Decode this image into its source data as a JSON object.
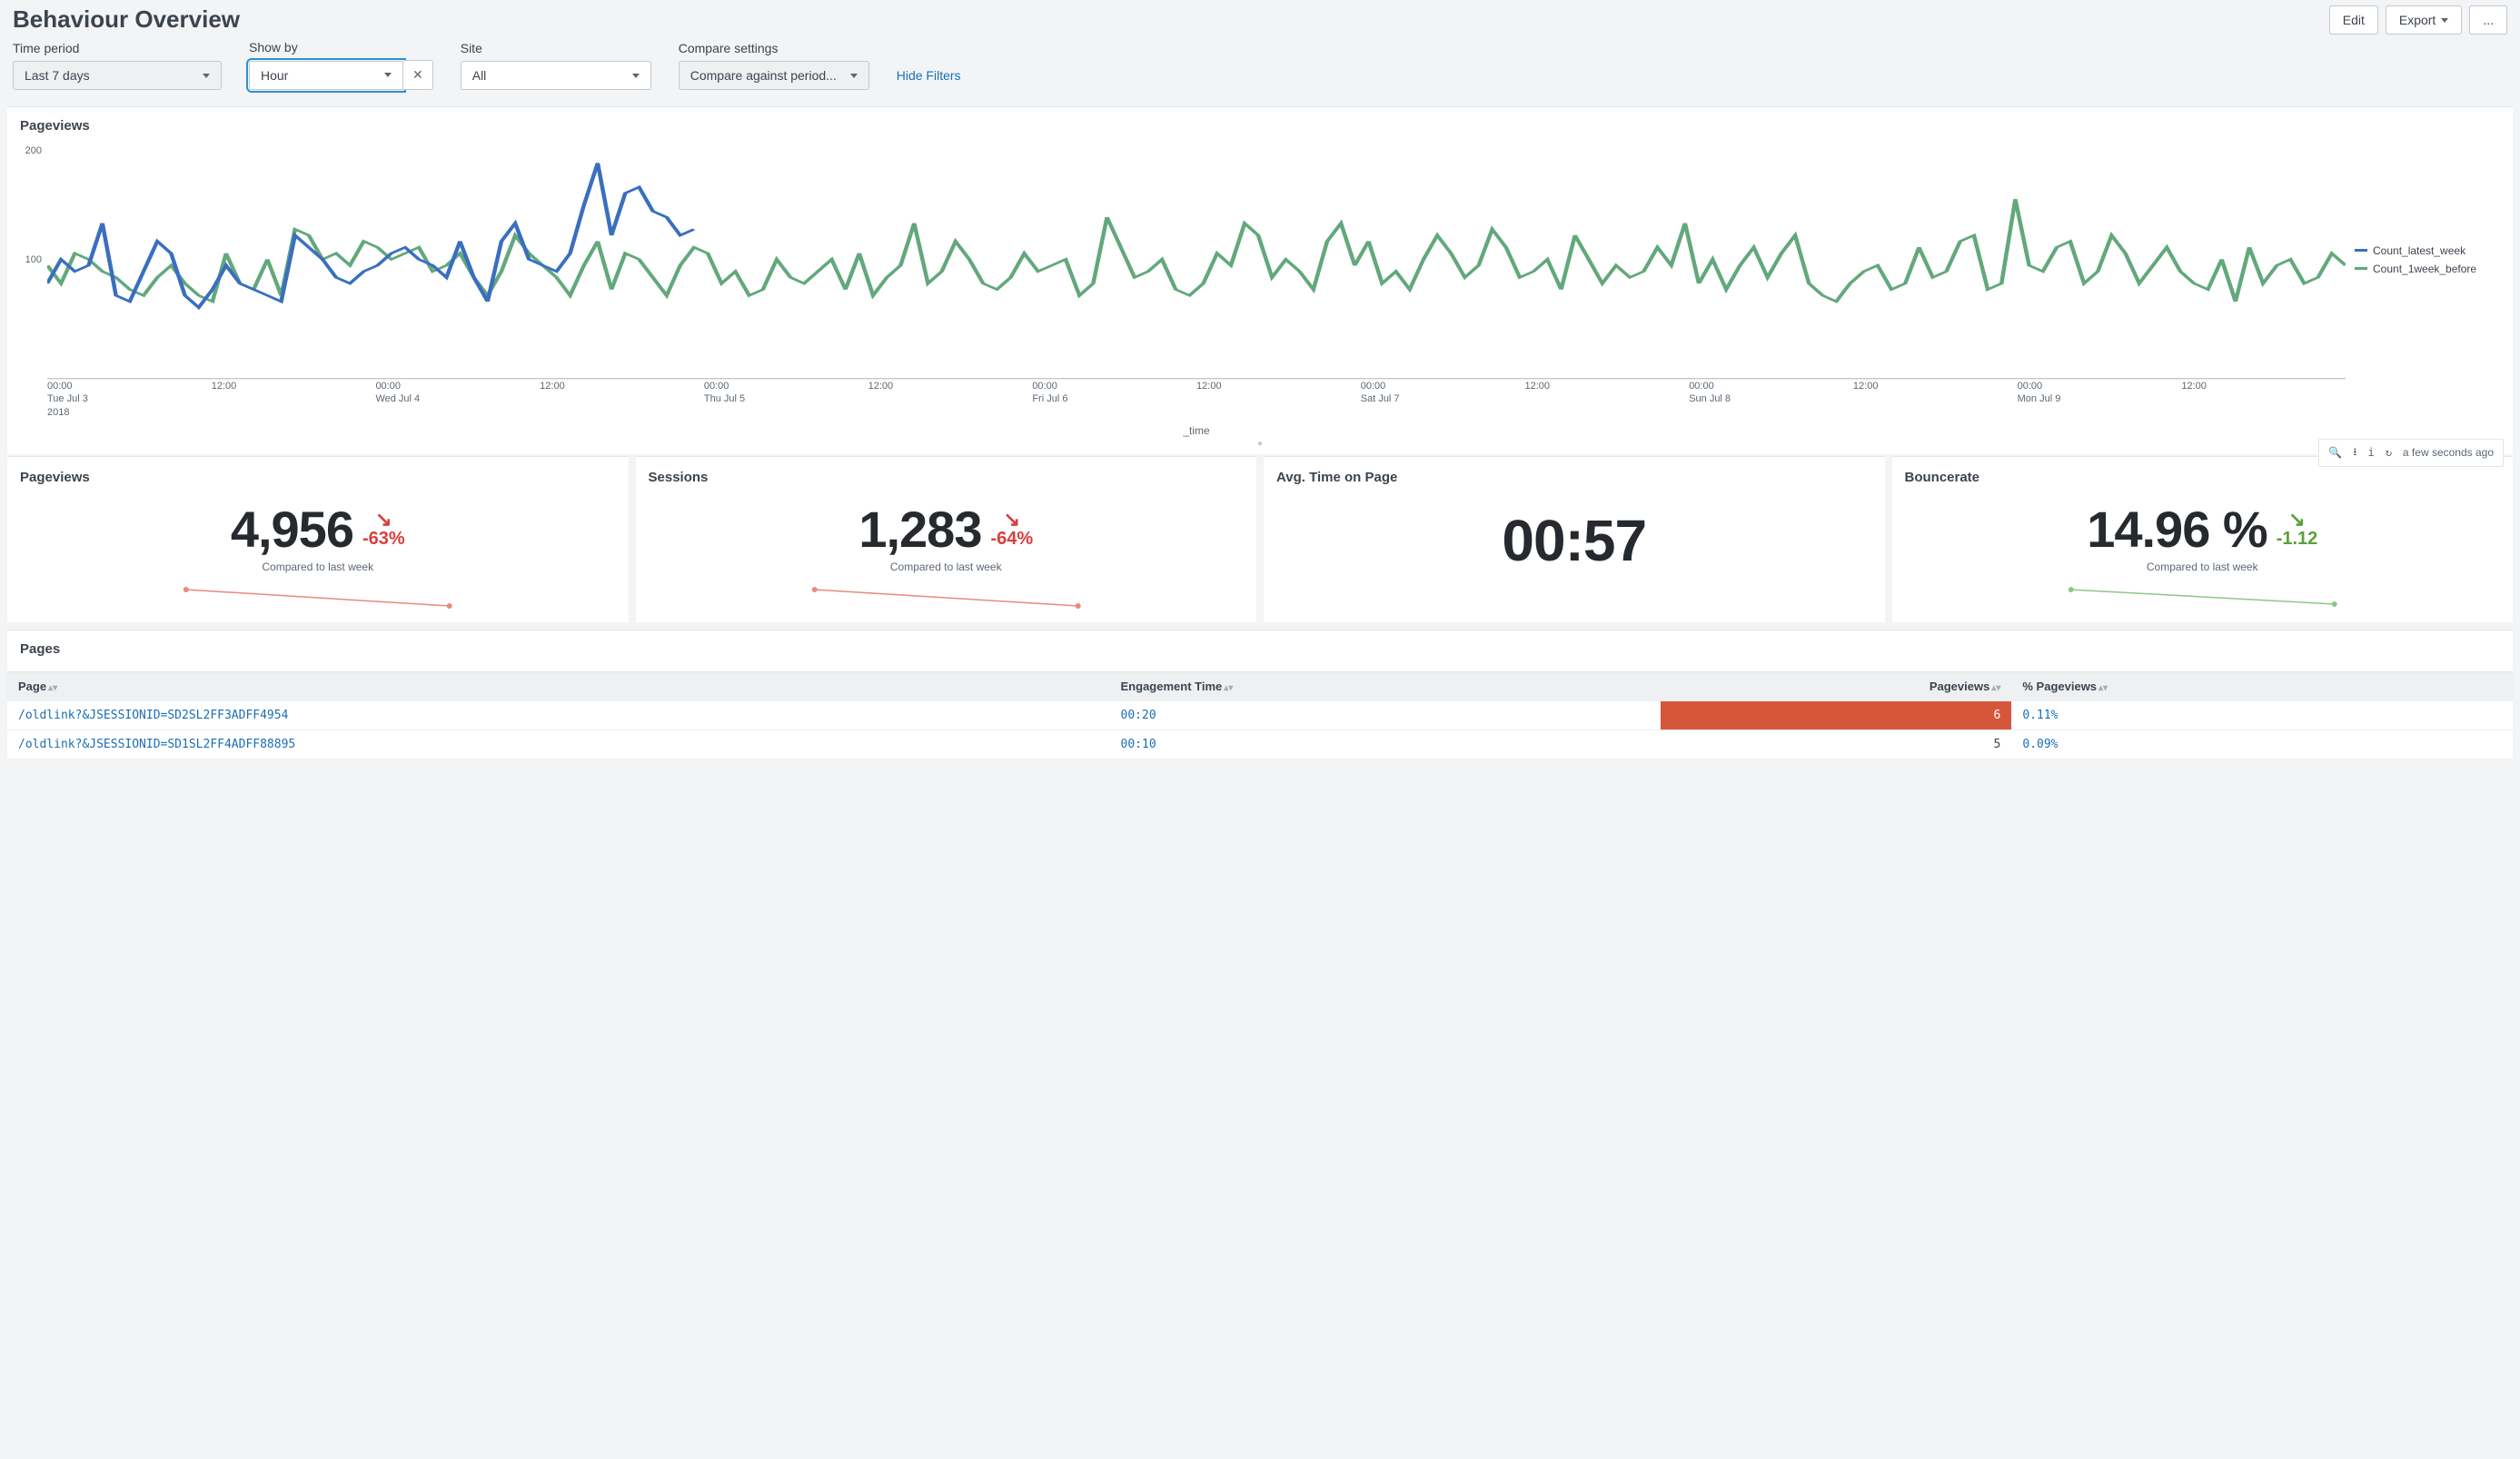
{
  "title": "Behaviour Overview",
  "actions": {
    "edit": "Edit",
    "export": "Export",
    "more": "..."
  },
  "filters": {
    "time_period": {
      "label": "Time period",
      "value": "Last 7 days"
    },
    "show_by": {
      "label": "Show by",
      "value": "Hour"
    },
    "site": {
      "label": "Site",
      "value": "All"
    },
    "compare": {
      "label": "Compare settings",
      "value": "Compare against period..."
    },
    "hide_filters": "Hide Filters"
  },
  "chart": {
    "title": "Pageviews",
    "x_label": "_time",
    "y_ticks": [
      "200",
      "100"
    ],
    "legend": [
      {
        "name": "Count_latest_week",
        "color": "#3a6fbf"
      },
      {
        "name": "Count_1week_before",
        "color": "#62a87c"
      }
    ],
    "x_ticks": [
      {
        "t1": "00:00",
        "t2": "Tue Jul 3",
        "t3": "2018"
      },
      {
        "t1": "12:00",
        "t2": "",
        "t3": ""
      },
      {
        "t1": "00:00",
        "t2": "Wed Jul 4",
        "t3": ""
      },
      {
        "t1": "12:00",
        "t2": "",
        "t3": ""
      },
      {
        "t1": "00:00",
        "t2": "Thu Jul 5",
        "t3": ""
      },
      {
        "t1": "12:00",
        "t2": "",
        "t3": ""
      },
      {
        "t1": "00:00",
        "t2": "Fri Jul 6",
        "t3": ""
      },
      {
        "t1": "12:00",
        "t2": "",
        "t3": ""
      },
      {
        "t1": "00:00",
        "t2": "Sat Jul 7",
        "t3": ""
      },
      {
        "t1": "12:00",
        "t2": "",
        "t3": ""
      },
      {
        "t1": "00:00",
        "t2": "Sun Jul 8",
        "t3": ""
      },
      {
        "t1": "12:00",
        "t2": "",
        "t3": ""
      },
      {
        "t1": "00:00",
        "t2": "Mon Jul 9",
        "t3": ""
      },
      {
        "t1": "12:00",
        "t2": "",
        "t3": ""
      }
    ]
  },
  "chart_data": {
    "type": "line",
    "xlabel": "_time",
    "ylabel": "",
    "ylim": [
      0,
      200
    ],
    "x": [
      "Jul3 00",
      "Jul3 01",
      "Jul3 02",
      "Jul3 03",
      "Jul3 04",
      "Jul3 05",
      "Jul3 06",
      "Jul3 07",
      "Jul3 08",
      "Jul3 09",
      "Jul3 10",
      "Jul3 11",
      "Jul3 12",
      "Jul3 13",
      "Jul3 14",
      "Jul3 15",
      "Jul3 16",
      "Jul3 17",
      "Jul3 18",
      "Jul3 19",
      "Jul3 20",
      "Jul3 21",
      "Jul3 22",
      "Jul3 23",
      "Jul4 00",
      "Jul4 01",
      "Jul4 02",
      "Jul4 03",
      "Jul4 04",
      "Jul4 05",
      "Jul4 06",
      "Jul4 07",
      "Jul4 08",
      "Jul4 09",
      "Jul4 10",
      "Jul4 11",
      "Jul4 12",
      "Jul4 13",
      "Jul4 14",
      "Jul4 15",
      "Jul4 16",
      "Jul4 17",
      "Jul4 18",
      "Jul4 19",
      "Jul4 20",
      "Jul4 21",
      "Jul4 22",
      "Jul4 23",
      "Jul5 00",
      "Jul5 01",
      "Jul5 02",
      "Jul5 03",
      "Jul5 04",
      "Jul5 05",
      "Jul5 06",
      "Jul5 07",
      "Jul5 08",
      "Jul5 09",
      "Jul5 10",
      "Jul5 11",
      "Jul5 12",
      "Jul5 13",
      "Jul5 14",
      "Jul5 15",
      "Jul5 16",
      "Jul5 17",
      "Jul5 18",
      "Jul5 19",
      "Jul5 20",
      "Jul5 21",
      "Jul5 22",
      "Jul5 23",
      "Jul6 00",
      "Jul6 01",
      "Jul6 02",
      "Jul6 03",
      "Jul6 04",
      "Jul6 05",
      "Jul6 06",
      "Jul6 07",
      "Jul6 08",
      "Jul6 09",
      "Jul6 10",
      "Jul6 11",
      "Jul6 12",
      "Jul6 13",
      "Jul6 14",
      "Jul6 15",
      "Jul6 16",
      "Jul6 17",
      "Jul6 18",
      "Jul6 19",
      "Jul6 20",
      "Jul6 21",
      "Jul6 22",
      "Jul6 23",
      "Jul7 00",
      "Jul7 01",
      "Jul7 02",
      "Jul7 03",
      "Jul7 04",
      "Jul7 05",
      "Jul7 06",
      "Jul7 07",
      "Jul7 08",
      "Jul7 09",
      "Jul7 10",
      "Jul7 11",
      "Jul7 12",
      "Jul7 13",
      "Jul7 14",
      "Jul7 15",
      "Jul7 16",
      "Jul7 17",
      "Jul7 18",
      "Jul7 19",
      "Jul7 20",
      "Jul7 21",
      "Jul7 22",
      "Jul7 23",
      "Jul8 00",
      "Jul8 01",
      "Jul8 02",
      "Jul8 03",
      "Jul8 04",
      "Jul8 05",
      "Jul8 06",
      "Jul8 07",
      "Jul8 08",
      "Jul8 09",
      "Jul8 10",
      "Jul8 11",
      "Jul8 12",
      "Jul8 13",
      "Jul8 14",
      "Jul8 15",
      "Jul8 16",
      "Jul8 17",
      "Jul8 18",
      "Jul8 19",
      "Jul8 20",
      "Jul8 21",
      "Jul8 22",
      "Jul8 23",
      "Jul9 00",
      "Jul9 01",
      "Jul9 02",
      "Jul9 03",
      "Jul9 04",
      "Jul9 05",
      "Jul9 06",
      "Jul9 07",
      "Jul9 08",
      "Jul9 09",
      "Jul9 10",
      "Jul9 11",
      "Jul9 12",
      "Jul9 13",
      "Jul9 14",
      "Jul9 15",
      "Jul9 16",
      "Jul9 17",
      "Jul9 18",
      "Jul9 19",
      "Jul9 20",
      "Jul9 21",
      "Jul9 22",
      "Jul9 23"
    ],
    "series": [
      {
        "name": "Count_latest_week",
        "color": "#3a6fbf",
        "values": [
          80,
          100,
          90,
          95,
          130,
          70,
          65,
          90,
          115,
          105,
          70,
          60,
          75,
          95,
          80,
          75,
          70,
          65,
          120,
          110,
          100,
          85,
          80,
          90,
          95,
          105,
          110,
          100,
          95,
          85,
          115,
          85,
          65,
          115,
          130,
          100,
          95,
          90,
          105,
          145,
          180,
          120,
          155,
          160,
          140,
          135,
          120,
          125
        ]
      },
      {
        "name": "Count_1week_before",
        "color": "#62a87c",
        "values": [
          95,
          80,
          105,
          100,
          90,
          85,
          75,
          70,
          85,
          95,
          80,
          70,
          65,
          105,
          80,
          75,
          100,
          70,
          125,
          120,
          100,
          105,
          95,
          115,
          110,
          100,
          105,
          110,
          90,
          95,
          105,
          85,
          70,
          90,
          120,
          105,
          95,
          85,
          70,
          95,
          115,
          75,
          105,
          100,
          85,
          70,
          95,
          110,
          105,
          80,
          90,
          70,
          75,
          100,
          85,
          80,
          90,
          100,
          75,
          105,
          70,
          85,
          95,
          130,
          80,
          90,
          115,
          100,
          80,
          75,
          85,
          105,
          90,
          95,
          100,
          70,
          80,
          135,
          110,
          85,
          90,
          100,
          75,
          70,
          80,
          105,
          95,
          130,
          120,
          85,
          100,
          90,
          75,
          115,
          130,
          95,
          115,
          80,
          90,
          75,
          100,
          120,
          105,
          85,
          95,
          125,
          110,
          85,
          90,
          100,
          75,
          120,
          100,
          80,
          95,
          85,
          90,
          110,
          95,
          130,
          80,
          100,
          75,
          95,
          110,
          85,
          105,
          120,
          80,
          70,
          65,
          80,
          90,
          95,
          75,
          80,
          110,
          85,
          90,
          115,
          120,
          75,
          80,
          150,
          95,
          90,
          110,
          115,
          80,
          90,
          120,
          105,
          80,
          95,
          110,
          90,
          80,
          75,
          100,
          65,
          110,
          80,
          95,
          100,
          80,
          85,
          105,
          95
        ]
      }
    ]
  },
  "toolbar": {
    "refresh_text": "a few seconds ago"
  },
  "kpis": {
    "pageviews": {
      "title": "Pageviews",
      "value": "4,956",
      "delta": "-63%",
      "delta_dir": "down",
      "delta_color": "red",
      "sub": "Compared to last week"
    },
    "sessions": {
      "title": "Sessions",
      "value": "1,283",
      "delta": "-64%",
      "delta_dir": "down",
      "delta_color": "red",
      "sub": "Compared to last week"
    },
    "avg_time": {
      "title": "Avg. Time on Page",
      "value": "00:57"
    },
    "bouncerate": {
      "title": "Bouncerate",
      "value": "14.96 %",
      "delta": "-1.12",
      "delta_dir": "down",
      "delta_color": "green",
      "sub": "Compared to last week"
    }
  },
  "pages": {
    "title": "Pages",
    "columns": [
      "Page",
      "Engagement Time",
      "Pageviews",
      "% Pageviews"
    ],
    "rows": [
      {
        "page": "/oldlink?&JSESSIONID=SD2SL2FF3ADFF4954",
        "engagement": "00:20",
        "pv": "6",
        "pct": "0.11%",
        "hl": true
      },
      {
        "page": "/oldlink?&JSESSIONID=SD1SL2FF4ADFF88895",
        "engagement": "00:10",
        "pv": "5",
        "pct": "0.09%",
        "hl": false
      }
    ]
  }
}
